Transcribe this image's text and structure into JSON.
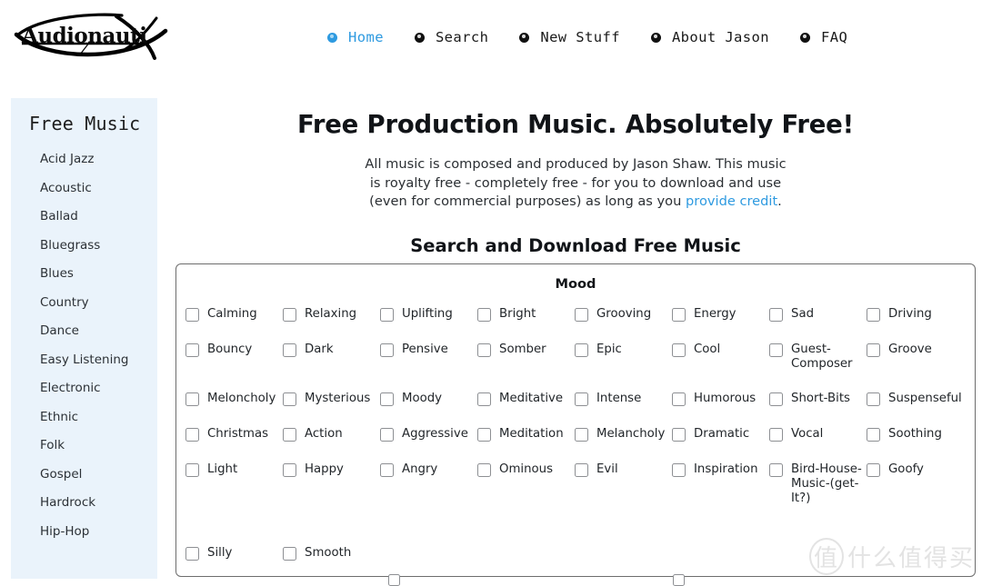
{
  "brand": {
    "logo_text": "Audionautix",
    "logo_icon": "audionautix-swoosh-logo"
  },
  "nav": {
    "items": [
      {
        "label": "Home",
        "active": true
      },
      {
        "label": "Search",
        "active": false
      },
      {
        "label": "New Stuff",
        "active": false
      },
      {
        "label": "About Jason",
        "active": false
      },
      {
        "label": "FAQ",
        "active": false
      }
    ]
  },
  "sidebar": {
    "title": "Free Music",
    "items": [
      {
        "label": "Acid Jazz"
      },
      {
        "label": "Acoustic"
      },
      {
        "label": "Ballad"
      },
      {
        "label": "Bluegrass"
      },
      {
        "label": "Blues"
      },
      {
        "label": "Country"
      },
      {
        "label": "Dance"
      },
      {
        "label": "Easy Listening"
      },
      {
        "label": "Electronic"
      },
      {
        "label": "Ethnic"
      },
      {
        "label": "Folk"
      },
      {
        "label": "Gospel"
      },
      {
        "label": "Hardrock"
      },
      {
        "label": "Hip-Hop"
      }
    ]
  },
  "hero": {
    "title": "Free Production Music. Absolutely Free!",
    "paragraph_before": "All music is composed and produced by Jason Shaw. This music is royalty free - completely free - for you to download and use (even for commercial purposes) as long as you ",
    "link_text": "provide credit",
    "paragraph_after": ".",
    "section_title": "Search and Download Free Music"
  },
  "mood_panel": {
    "title": "Mood",
    "columns": 8,
    "checkboxes": [
      {
        "label": "Calming",
        "checked": false
      },
      {
        "label": "Relaxing",
        "checked": false
      },
      {
        "label": "Uplifting",
        "checked": false
      },
      {
        "label": "Bright",
        "checked": false
      },
      {
        "label": "Grooving",
        "checked": false
      },
      {
        "label": "Energy",
        "checked": false
      },
      {
        "label": "Sad",
        "checked": false
      },
      {
        "label": "Driving",
        "checked": false
      },
      {
        "label": "Bouncy",
        "checked": false
      },
      {
        "label": "Dark",
        "checked": false
      },
      {
        "label": "Pensive",
        "checked": false
      },
      {
        "label": "Somber",
        "checked": false
      },
      {
        "label": "Epic",
        "checked": false
      },
      {
        "label": "Cool",
        "checked": false
      },
      {
        "label": "Guest-Composer",
        "checked": false
      },
      {
        "label": "Groove",
        "checked": false
      },
      {
        "label": "Meloncholy",
        "checked": false
      },
      {
        "label": "Mysterious",
        "checked": false
      },
      {
        "label": "Moody",
        "checked": false
      },
      {
        "label": "Meditative",
        "checked": false
      },
      {
        "label": "Intense",
        "checked": false
      },
      {
        "label": "Humorous",
        "checked": false
      },
      {
        "label": "Short-Bits",
        "checked": false
      },
      {
        "label": "Suspenseful",
        "checked": false
      },
      {
        "label": "Christmas",
        "checked": false
      },
      {
        "label": "Action",
        "checked": false
      },
      {
        "label": "Aggressive",
        "checked": false
      },
      {
        "label": "Meditation",
        "checked": false
      },
      {
        "label": "Melancholy",
        "checked": false
      },
      {
        "label": "Dramatic",
        "checked": false
      },
      {
        "label": "Vocal",
        "checked": false
      },
      {
        "label": "Soothing",
        "checked": false
      },
      {
        "label": "Light",
        "checked": false
      },
      {
        "label": "Happy",
        "checked": false
      },
      {
        "label": "Angry",
        "checked": false
      },
      {
        "label": "Ominous",
        "checked": false
      },
      {
        "label": "Evil",
        "checked": false
      },
      {
        "label": "Inspiration",
        "checked": false
      },
      {
        "label": "Bird-House-Music-(get-It?)",
        "checked": false
      },
      {
        "label": "Goofy",
        "checked": false
      },
      {
        "label": "Silly",
        "checked": false
      },
      {
        "label": "Smooth",
        "checked": false
      }
    ]
  },
  "watermark": {
    "circle_text": "值",
    "text": "什么值得买"
  },
  "colors": {
    "accent_blue": "#2e9ae0",
    "sidebar_bg": "#eaf3fb",
    "panel_border": "#6d6d6d",
    "text": "#212529"
  }
}
